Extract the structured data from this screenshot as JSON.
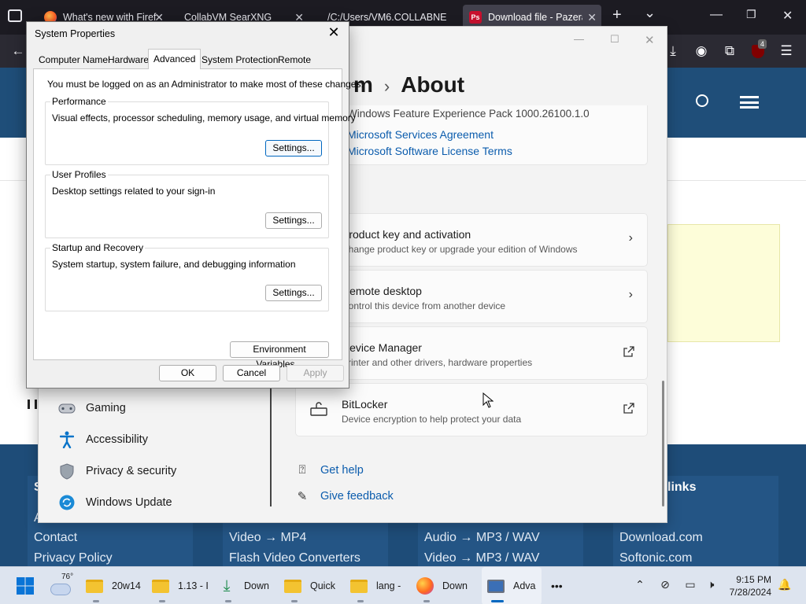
{
  "browser": {
    "tabs": [
      {
        "title": "What's new with Firef",
        "favicon": "firefox-icon"
      },
      {
        "title": "CollabVM SearXNG",
        "favicon": "none"
      },
      {
        "title": "/C:/Users/VM6.COLLABNE",
        "favicon": "none"
      },
      {
        "title": "Download file - Pazera",
        "favicon": "pazera-icon",
        "active": true
      }
    ],
    "new_tab_symbol": "+",
    "list_tabs_symbol": "⌄",
    "extension_badge": "4"
  },
  "webpage": {
    "footer": {
      "col1": {
        "heading": "S",
        "links": [
          "A",
          "Contact",
          "Privacy Policy"
        ]
      },
      "col2": {
        "links": [
          "Video → MP4",
          "Flash Video Converters"
        ]
      },
      "col3": {
        "links": [
          "Audio → MP3 / WAV",
          "Video → MP3 / WAV"
        ]
      },
      "col4": {
        "heading": "links",
        "links": [
          "Download.com",
          "Softonic.com"
        ]
      }
    }
  },
  "settings": {
    "breadcrumb_parent": "m",
    "breadcrumb_current": "About",
    "info_text": "Windows Feature Experience Pack 1000.26100.1.0",
    "links": [
      "Microsoft Services Agreement",
      "Microsoft Software License Terms"
    ],
    "cards": [
      {
        "title": "Product key and activation",
        "subtitle": "Change product key or upgrade your edition of Windows",
        "action": "chevron"
      },
      {
        "title": "Remote desktop",
        "subtitle": "Control this device from another device",
        "action": "chevron"
      },
      {
        "title": "Device Manager",
        "subtitle": "Printer and other drivers, hardware properties",
        "action": "external"
      },
      {
        "title": "BitLocker",
        "subtitle": "Device encryption to help protect your data",
        "action": "external"
      }
    ],
    "sidebar": [
      {
        "label": "Gaming",
        "icon": "gaming-icon"
      },
      {
        "label": "Accessibility",
        "icon": "accessibility-icon"
      },
      {
        "label": "Privacy & security",
        "icon": "shield-icon"
      },
      {
        "label": "Windows Update",
        "icon": "windows-update-icon"
      }
    ],
    "help": [
      {
        "label": "Get help",
        "icon": "help-icon"
      },
      {
        "label": "Give feedback",
        "icon": "feedback-icon"
      }
    ]
  },
  "system_properties": {
    "title": "System Properties",
    "tabs": [
      "Computer Name",
      "Hardware",
      "Advanced",
      "System Protection",
      "Remote"
    ],
    "active_tab": "Advanced",
    "admin_note": "You must be logged on as an Administrator to make most of these changes.",
    "groups": [
      {
        "title": "Performance",
        "description": "Visual effects, processor scheduling, memory usage, and virtual memory",
        "button": "Settings..."
      },
      {
        "title": "User Profiles",
        "description": "Desktop settings related to your sign-in",
        "button": "Settings..."
      },
      {
        "title": "Startup and Recovery",
        "description": "System startup, system failure, and debugging information",
        "button": "Settings..."
      }
    ],
    "env_button": "Environment Variables...",
    "ok": "OK",
    "cancel": "Cancel",
    "apply": "Apply"
  },
  "taskbar": {
    "weather_temp": "76°",
    "items": [
      {
        "label": "20w14",
        "icon": "folder-icon"
      },
      {
        "label": "1.13 - I",
        "icon": "folder-icon"
      },
      {
        "label": "Down",
        "icon": "download-icon"
      },
      {
        "label": "Quick",
        "icon": "folder-icon"
      },
      {
        "label": "lang -",
        "icon": "folder-icon"
      },
      {
        "label": "Down",
        "icon": "firefox-icon"
      },
      {
        "label": "Adva",
        "icon": "system-properties-icon",
        "active": true
      }
    ],
    "overflow": "•••",
    "time": "9:15 PM",
    "date": "7/28/2024"
  },
  "colors": {
    "page_header": "#1f4e79",
    "accent": "#0067c0",
    "link": "#0b5cad",
    "firefox_tabbar": "#1c1b22"
  }
}
